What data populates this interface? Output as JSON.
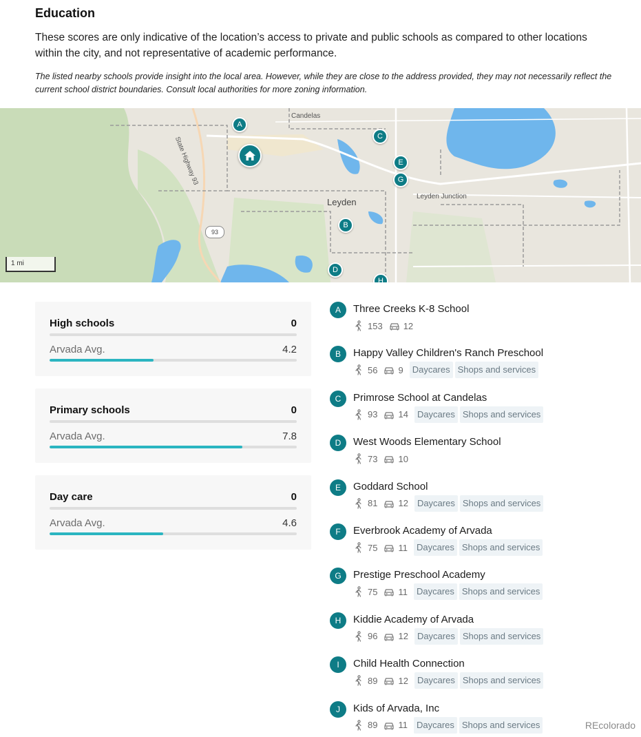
{
  "education": {
    "title": "Education",
    "intro": "These scores are only indicative of the location’s access to private and public schools as compared to other locations within the city, and not representative of academic performance.",
    "disclaimer": "The listed nearby schools provide insight into the local area. However, while they are close to the address provided, they may not necessarily reflect the current school district boundaries. Consult local authorities for more zoning information."
  },
  "map": {
    "labels": {
      "candelas": "Candelas",
      "leyden": "Leyden",
      "leyden_junction": "Leyden Junction",
      "highway": "State Highway 93",
      "route": "93"
    },
    "scale": "1 mi",
    "pins": [
      "A",
      "B",
      "C",
      "D",
      "E",
      "G",
      "H"
    ],
    "colors": {
      "pin": "#0e7c86",
      "water": "#6fb6ec",
      "park": "#c9dcb8",
      "land": "#e9e6de"
    }
  },
  "scores": [
    {
      "name": "High schools",
      "score": "0",
      "avg_label": "Arvada Avg.",
      "avg": "4.2",
      "avg_fraction": 0.42
    },
    {
      "name": "Primary schools",
      "score": "0",
      "avg_label": "Arvada Avg.",
      "avg": "7.8",
      "avg_fraction": 0.78
    },
    {
      "name": "Day care",
      "score": "0",
      "avg_label": "Arvada Avg.",
      "avg": "4.6",
      "avg_fraction": 0.46
    }
  ],
  "schools": [
    {
      "letter": "A",
      "name": "Three Creeks K-8 School",
      "walk": "153",
      "drive": "12",
      "tags": []
    },
    {
      "letter": "B",
      "name": "Happy Valley Children's Ranch Preschool",
      "walk": "56",
      "drive": "9",
      "tags": [
        "Daycares",
        "Shops and services"
      ]
    },
    {
      "letter": "C",
      "name": "Primrose School at Candelas",
      "walk": "93",
      "drive": "14",
      "tags": [
        "Daycares",
        "Shops and services"
      ]
    },
    {
      "letter": "D",
      "name": "West Woods Elementary School",
      "walk": "73",
      "drive": "10",
      "tags": []
    },
    {
      "letter": "E",
      "name": "Goddard School",
      "walk": "81",
      "drive": "12",
      "tags": [
        "Daycares",
        "Shops and services"
      ]
    },
    {
      "letter": "F",
      "name": "Everbrook Academy of Arvada",
      "walk": "75",
      "drive": "11",
      "tags": [
        "Daycares",
        "Shops and services"
      ]
    },
    {
      "letter": "G",
      "name": "Prestige Preschool Academy",
      "walk": "75",
      "drive": "11",
      "tags": [
        "Daycares",
        "Shops and services"
      ]
    },
    {
      "letter": "H",
      "name": "Kiddie Academy of Arvada",
      "walk": "96",
      "drive": "12",
      "tags": [
        "Daycares",
        "Shops and services"
      ]
    },
    {
      "letter": "I",
      "name": "Child Health Connection",
      "walk": "89",
      "drive": "12",
      "tags": [
        "Daycares",
        "Shops and services"
      ]
    },
    {
      "letter": "J",
      "name": "Kids of Arvada, Inc",
      "walk": "89",
      "drive": "11",
      "tags": [
        "Daycares",
        "Shops and services"
      ]
    }
  ],
  "footer": {
    "brand": "REcolorado"
  }
}
